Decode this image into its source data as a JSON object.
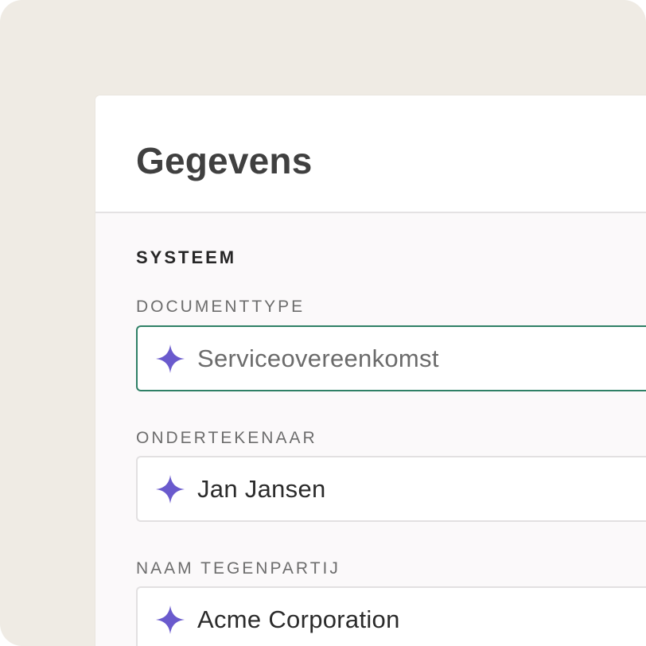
{
  "colors": {
    "backdrop": "#efebe4",
    "accent_spark": "#6a5acd",
    "focus_border": "#2f8066"
  },
  "panel": {
    "title": "Gegevens"
  },
  "section": {
    "title": "SYSTEEM"
  },
  "fields": [
    {
      "label": "DOCUMENTTYPE",
      "value": "Serviceovereenkomst",
      "icon": "ai-sparkle-icon",
      "focused": true
    },
    {
      "label": "ONDERTEKENAAR",
      "value": "Jan Jansen",
      "icon": "ai-sparkle-icon",
      "focused": false
    },
    {
      "label": "NAAM TEGENPARTIJ",
      "value": "Acme Corporation",
      "icon": "ai-sparkle-icon",
      "focused": false
    }
  ]
}
